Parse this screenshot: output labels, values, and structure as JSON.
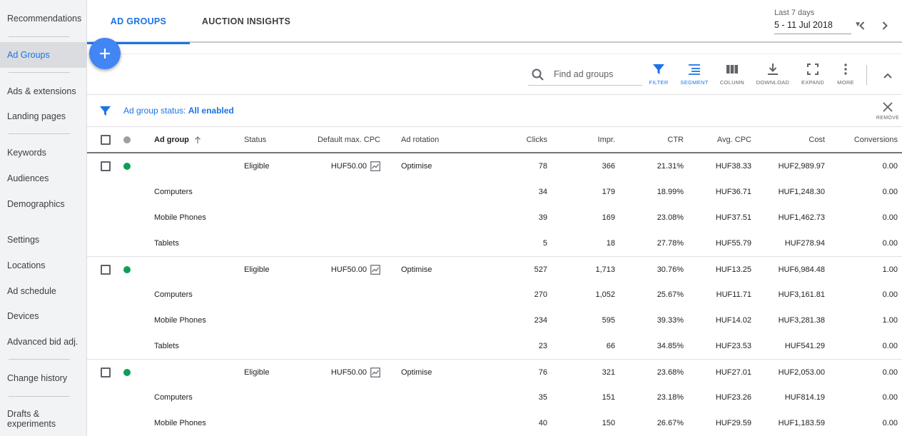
{
  "sidebar": {
    "items": [
      {
        "label": "Recommendations"
      },
      {
        "label": "Ad Groups"
      },
      {
        "label": "Ads & extensions"
      },
      {
        "label": "Landing pages"
      },
      {
        "label": "Keywords"
      },
      {
        "label": "Audiences"
      },
      {
        "label": "Demographics"
      },
      {
        "label": "Settings"
      },
      {
        "label": "Locations"
      },
      {
        "label": "Ad schedule"
      },
      {
        "label": "Devices"
      },
      {
        "label": "Advanced bid adj."
      },
      {
        "label": "Change history"
      },
      {
        "label": "Drafts &"
      }
    ],
    "drafts_line2": "experiments"
  },
  "header": {
    "tabs": [
      {
        "label": "AD GROUPS"
      },
      {
        "label": "AUCTION INSIGHTS"
      }
    ],
    "date_caption": "Last 7 days",
    "date_range": "5 - 11 Jul 2018"
  },
  "toolbar": {
    "search_placeholder": "Find ad groups",
    "tools": [
      {
        "label": "FILTER"
      },
      {
        "label": "SEGMENT"
      },
      {
        "label": "COLUMN"
      },
      {
        "label": "DOWNLOAD"
      },
      {
        "label": "EXPAND"
      },
      {
        "label": "MORE"
      }
    ]
  },
  "filter": {
    "prefix": "Ad group status: ",
    "value": "All enabled",
    "remove_label": "REMOVE"
  },
  "table": {
    "headers": {
      "ad_group": "Ad group",
      "status": "Status",
      "default_cpc": "Default max. CPC",
      "ad_rotation": "Ad rotation",
      "clicks": "Clicks",
      "impr": "Impr.",
      "ctr": "CTR",
      "avg_cpc": "Avg. CPC",
      "cost": "Cost",
      "conversions": "Conversions"
    },
    "groups": [
      {
        "status_color": "#0f9d58",
        "row": {
          "name": "",
          "status": "Eligible",
          "default_cpc": "HUF50.00",
          "ad_rotation": "Optimise",
          "clicks": "78",
          "impr": "366",
          "ctr": "21.31%",
          "avg_cpc": "HUF38.33",
          "cost": "HUF2,989.97",
          "conversions": "0.00"
        },
        "segments": [
          {
            "name": "Computers",
            "clicks": "34",
            "impr": "179",
            "ctr": "18.99%",
            "avg_cpc": "HUF36.71",
            "cost": "HUF1,248.30",
            "conversions": "0.00"
          },
          {
            "name": "Mobile Phones",
            "clicks": "39",
            "impr": "169",
            "ctr": "23.08%",
            "avg_cpc": "HUF37.51",
            "cost": "HUF1,462.73",
            "conversions": "0.00"
          },
          {
            "name": "Tablets",
            "clicks": "5",
            "impr": "18",
            "ctr": "27.78%",
            "avg_cpc": "HUF55.79",
            "cost": "HUF278.94",
            "conversions": "0.00"
          }
        ]
      },
      {
        "status_color": "#0f9d58",
        "row": {
          "name": "",
          "status": "Eligible",
          "default_cpc": "HUF50.00",
          "ad_rotation": "Optimise",
          "clicks": "527",
          "impr": "1,713",
          "ctr": "30.76%",
          "avg_cpc": "HUF13.25",
          "cost": "HUF6,984.48",
          "conversions": "1.00"
        },
        "segments": [
          {
            "name": "Computers",
            "clicks": "270",
            "impr": "1,052",
            "ctr": "25.67%",
            "avg_cpc": "HUF11.71",
            "cost": "HUF3,161.81",
            "conversions": "0.00"
          },
          {
            "name": "Mobile Phones",
            "clicks": "234",
            "impr": "595",
            "ctr": "39.33%",
            "avg_cpc": "HUF14.02",
            "cost": "HUF3,281.38",
            "conversions": "1.00"
          },
          {
            "name": "Tablets",
            "clicks": "23",
            "impr": "66",
            "ctr": "34.85%",
            "avg_cpc": "HUF23.53",
            "cost": "HUF541.29",
            "conversions": "0.00"
          }
        ]
      },
      {
        "status_color": "#0f9d58",
        "row": {
          "name": "",
          "status": "Eligible",
          "default_cpc": "HUF50.00",
          "ad_rotation": "Optimise",
          "clicks": "76",
          "impr": "321",
          "ctr": "23.68%",
          "avg_cpc": "HUF27.01",
          "cost": "HUF2,053.00",
          "conversions": "0.00"
        },
        "segments": [
          {
            "name": "Computers",
            "clicks": "35",
            "impr": "151",
            "ctr": "23.18%",
            "avg_cpc": "HUF23.26",
            "cost": "HUF814.19",
            "conversions": "0.00"
          },
          {
            "name": "Mobile Phones",
            "clicks": "40",
            "impr": "150",
            "ctr": "26.67%",
            "avg_cpc": "HUF29.59",
            "cost": "HUF1,183.59",
            "conversions": "0.00"
          }
        ]
      }
    ]
  }
}
